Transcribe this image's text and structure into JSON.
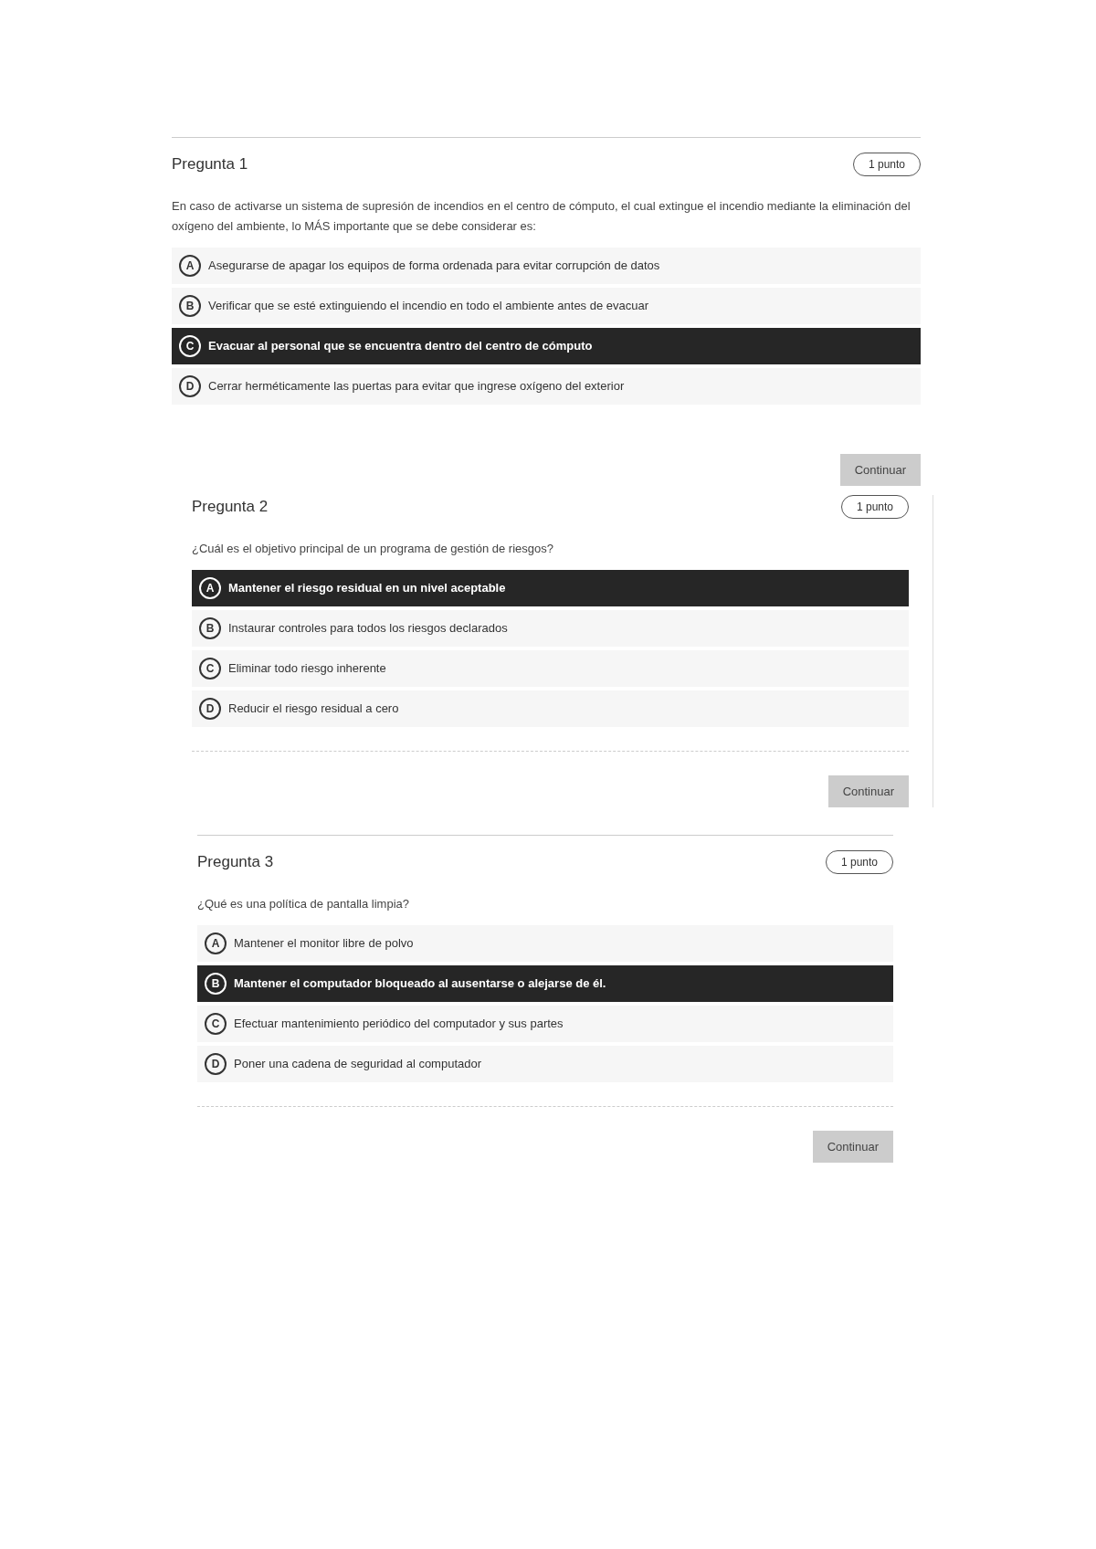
{
  "questions": [
    {
      "title": "Pregunta 1",
      "points": "1 punto",
      "prompt": "En caso de activarse un sistema de supresión de incendios en el centro de cómputo, el cual extingue el incendio mediante la eliminación del oxígeno del ambiente, lo MÁS importante que se debe considerar es:",
      "top_rule": true,
      "bottom_rule": false,
      "options": [
        {
          "letter": "A",
          "text": "Asegurarse de apagar los equipos de forma ordenada para evitar corrupción de datos",
          "selected": false
        },
        {
          "letter": "B",
          "text": "Verificar que se esté extinguiendo el incendio en todo el ambiente antes de evacuar",
          "selected": false
        },
        {
          "letter": "C",
          "text": "Evacuar al personal que se encuentra dentro del centro de cómputo",
          "selected": true
        },
        {
          "letter": "D",
          "text": "Cerrar herméticamente las puertas para evitar que ingrese oxígeno del exterior",
          "selected": false
        }
      ],
      "button": "Continuar"
    },
    {
      "title": "Pregunta 2",
      "points": "1 punto",
      "prompt": "¿Cuál es el objetivo principal de un programa de gestión de riesgos?",
      "top_rule": false,
      "bottom_rule": true,
      "options": [
        {
          "letter": "A",
          "text": "Mantener el riesgo residual en un nivel aceptable",
          "selected": true
        },
        {
          "letter": "B",
          "text": "Instaurar controles para todos los riesgos declarados",
          "selected": false
        },
        {
          "letter": "C",
          "text": "Eliminar todo riesgo inherente",
          "selected": false
        },
        {
          "letter": "D",
          "text": "Reducir el riesgo residual a cero",
          "selected": false
        }
      ],
      "button": "Continuar"
    },
    {
      "title": "Pregunta 3",
      "points": "1 punto",
      "prompt": "¿Qué es una política de pantalla limpia?",
      "top_rule": true,
      "bottom_rule": true,
      "options": [
        {
          "letter": "A",
          "text": "Mantener el monitor libre de polvo",
          "selected": false
        },
        {
          "letter": "B",
          "text": "Mantener el computador bloqueado al ausentarse o alejarse de él.",
          "selected": true
        },
        {
          "letter": "C",
          "text": "Efectuar mantenimiento periódico del computador y sus partes",
          "selected": false
        },
        {
          "letter": "D",
          "text": "Poner una cadena de seguridad al computador",
          "selected": false
        }
      ],
      "button": "Continuar"
    }
  ]
}
